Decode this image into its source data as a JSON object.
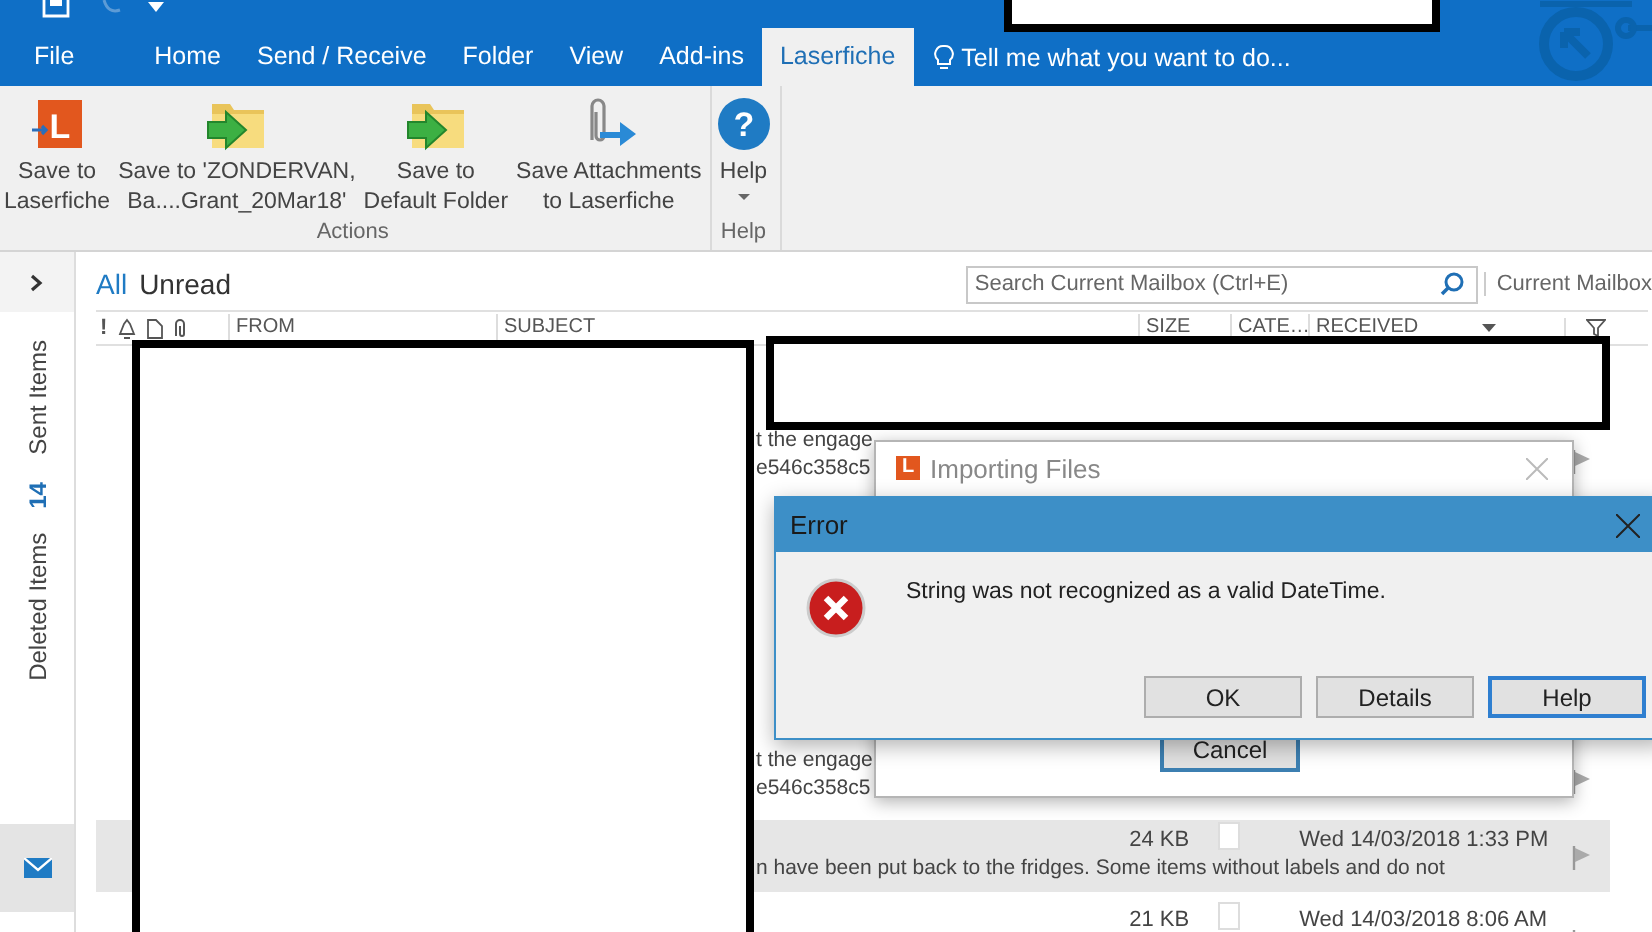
{
  "ribbon": {
    "tabs": [
      {
        "label": "File",
        "selected": false
      },
      {
        "label": "Home",
        "selected": false
      },
      {
        "label": "Send / Receive",
        "selected": false
      },
      {
        "label": "Folder",
        "selected": false
      },
      {
        "label": "View",
        "selected": false
      },
      {
        "label": "Add-ins",
        "selected": false
      },
      {
        "label": "Laserfiche",
        "selected": true
      }
    ],
    "tell_me": "Tell me what you want to do...",
    "groups": [
      {
        "label": "Actions",
        "buttons": [
          {
            "kind": "laserfiche",
            "lines": [
              "Save to",
              "Laserfiche"
            ],
            "icon_text": "L"
          },
          {
            "kind": "folder",
            "lines": [
              "Save to 'ZONDERVAN,",
              "Ba....Grant_20Mar18'"
            ]
          },
          {
            "kind": "folder",
            "lines": [
              "Save to",
              "Default Folder"
            ]
          },
          {
            "kind": "attachments",
            "lines": [
              "Save Attachments",
              "to Laserfiche"
            ]
          }
        ]
      },
      {
        "label": "Help",
        "buttons": [
          {
            "kind": "help",
            "lines": [
              "Help"
            ],
            "icon_text": "?",
            "dropdown": true
          }
        ]
      }
    ]
  },
  "nav": {
    "folders": [
      {
        "label": "Sent Items"
      },
      {
        "label": "Deleted Items",
        "count": "14"
      }
    ]
  },
  "filters": [
    {
      "label": "All",
      "selected": true
    },
    {
      "label": "Unread",
      "selected": false
    }
  ],
  "search": {
    "placeholder": "Search Current Mailbox (Ctrl+E)",
    "scope": "Current Mailbox"
  },
  "columns": {
    "importance": "!",
    "from": "FROM",
    "subject": "SUBJECT",
    "size": "SIZE",
    "categories": "CATE…",
    "received": "RECEIVED"
  },
  "rows": [
    {
      "line_1": "t the engage",
      "line_2": "e546c358c5",
      "selected": false
    },
    {
      "line_1": "t the engage",
      "line_2": "e546c358c5",
      "selected": false
    },
    {
      "size": "24 KB",
      "received": "Wed 14/03/2018 1:33 PM",
      "line_2": "n have been put back to the fridges.  Some items without labels and do not",
      "selected": true
    },
    {
      "size": "21 KB",
      "received": "Wed 14/03/2018 8:06 AM",
      "selected": false
    }
  ],
  "import_dialog": {
    "icon_text": "L",
    "title": "Importing Files",
    "button": "Cancel"
  },
  "error_dialog": {
    "title": "Error",
    "message": "String was not recognized as a valid DateTime.",
    "buttons": [
      {
        "label": "OK",
        "default": false
      },
      {
        "label": "Details",
        "default": false
      },
      {
        "label": "Help",
        "default": true
      }
    ]
  }
}
